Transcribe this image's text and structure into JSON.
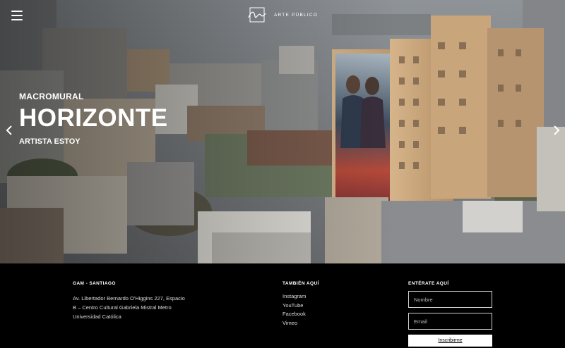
{
  "header": {
    "logo_text": "ARTE PÚBLICO"
  },
  "hero": {
    "kicker": "MACROMURAL",
    "title": "HORIZONTE",
    "artist": "ARTISTA ESTOY"
  },
  "footer": {
    "gam": {
      "title": "GAM - SANTIAGO",
      "address_lines": [
        "Av. Libertador Bernardo O'Higgins 227, Espacio",
        "B – Centro Cultural Gabriela Mistral Metro",
        "Universidad Católica"
      ]
    },
    "social": {
      "title": "TAMBIÉN AQUÍ",
      "links": [
        "Instagram",
        "YouTube",
        "Facebook",
        "Vimeo"
      ]
    },
    "newsletter": {
      "title": "ENTÉRATE AQUÍ",
      "name_placeholder": "Nombre",
      "email_placeholder": "Email",
      "submit_label": "Inscribirme"
    }
  },
  "icons": {
    "menu": "hamburger-menu-icon",
    "prev": "chevron-left-icon",
    "next": "chevron-right-icon"
  }
}
